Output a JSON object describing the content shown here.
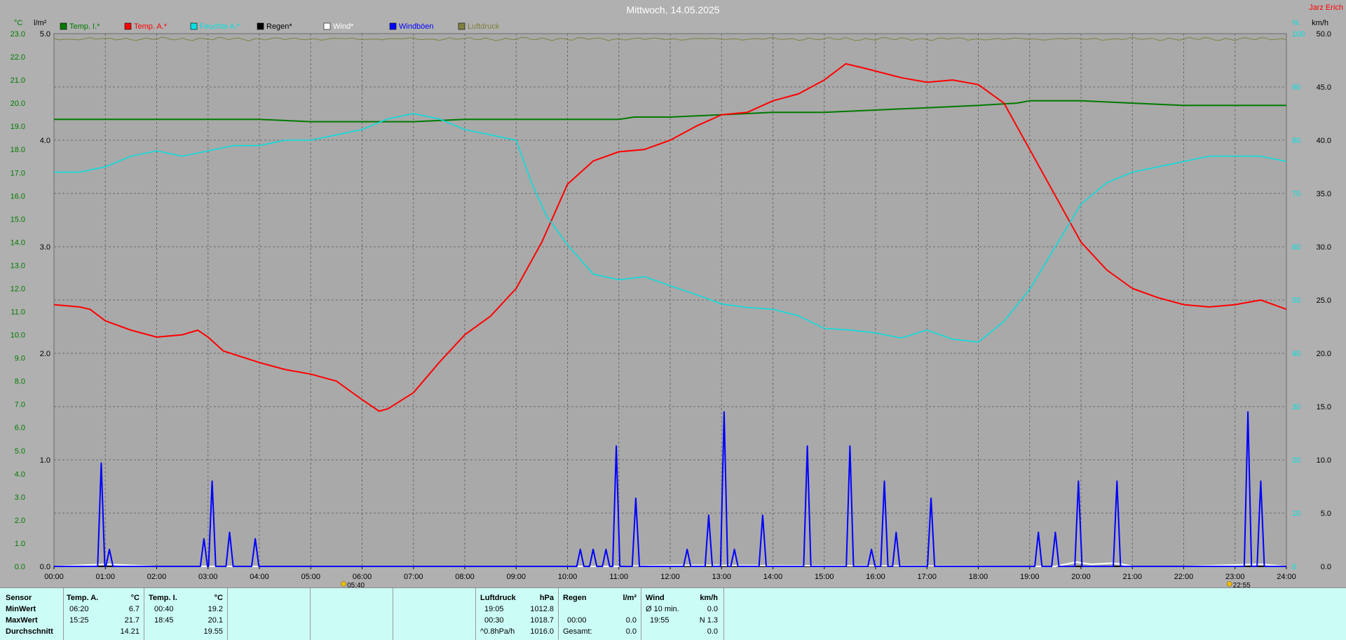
{
  "title": "Mittwoch, 14.05.2025",
  "author": "Jarz Erich",
  "axes": {
    "left_temp_unit": "°C",
    "left_rain_unit": "l/m²",
    "right_pct_unit": "%",
    "right_wind_unit": "km/h",
    "temp_ticks": [
      "0.0",
      "1.0",
      "2.0",
      "3.0",
      "4.0",
      "5.0",
      "6.0",
      "7.0",
      "8.0",
      "9.0",
      "10.0",
      "11.0",
      "12.0",
      "13.0",
      "14.0",
      "15.0",
      "16.0",
      "17.0",
      "18.0",
      "19.0",
      "20.0",
      "21.0",
      "22.0",
      "23.0"
    ],
    "rain_ticks": [
      "1.0",
      "2.0",
      "3.0",
      "4.0",
      "5.0"
    ],
    "pct_ticks": [
      "0",
      "10",
      "20",
      "30",
      "40",
      "50",
      "60",
      "70",
      "80",
      "90",
      "100"
    ],
    "wind_ticks": [
      "0.0",
      "5.0",
      "10.0",
      "15.0",
      "20.0",
      "25.0",
      "30.0",
      "35.0",
      "40.0",
      "45.0",
      "50.0"
    ],
    "x_ticks": [
      "00:00",
      "01:00",
      "02:00",
      "03:00",
      "04:00",
      "05:00",
      "06:00",
      "07:00",
      "08:00",
      "09:00",
      "10:00",
      "11:00",
      "12:00",
      "13:00",
      "14:00",
      "15:00",
      "16:00",
      "17:00",
      "18:00",
      "19:00",
      "20:00",
      "21:00",
      "22:00",
      "23:00",
      "24:00"
    ],
    "sunrise": "05:40",
    "sunset": "22:55"
  },
  "legend": [
    {
      "label": "Temp. I.*",
      "color": "#007a00"
    },
    {
      "label": "Temp. A.*",
      "color": "#ff0000"
    },
    {
      "label": "Feuchte A.*",
      "color": "#00e0e0"
    },
    {
      "label": "Regen*",
      "color": "#000000"
    },
    {
      "label": "Wind*",
      "color": "#ffffff"
    },
    {
      "label": "Windböen",
      "color": "#0000ff"
    },
    {
      "label": "Luftdruck",
      "color": "#808040"
    }
  ],
  "chart_data": {
    "type": "line",
    "x_unit": "hour",
    "xlim": [
      0,
      24
    ],
    "series": [
      {
        "name": "Temp. I.*",
        "axis": "temp",
        "ylim": [
          0,
          23
        ],
        "color": "#007a00",
        "x": [
          0,
          0.5,
          1,
          2,
          3,
          4,
          5,
          6,
          7,
          8,
          9,
          10,
          11,
          11.3,
          12,
          13,
          14,
          15,
          16,
          17,
          18,
          18.75,
          19,
          20,
          21,
          22,
          23,
          24
        ],
        "values": [
          19.3,
          19.3,
          19.3,
          19.3,
          19.3,
          19.3,
          19.2,
          19.2,
          19.2,
          19.3,
          19.3,
          19.3,
          19.3,
          19.4,
          19.4,
          19.5,
          19.6,
          19.6,
          19.7,
          19.8,
          19.9,
          20.0,
          20.1,
          20.1,
          20.0,
          19.9,
          19.9,
          19.9
        ]
      },
      {
        "name": "Temp. A.*",
        "axis": "temp",
        "ylim": [
          0,
          23
        ],
        "color": "#ff0000",
        "x": [
          0,
          0.5,
          0.7,
          1,
          1.5,
          2,
          2.5,
          2.8,
          3,
          3.3,
          4,
          4.5,
          5,
          5.5,
          6,
          6.33,
          6.5,
          7,
          7.5,
          8,
          8.5,
          9,
          9.5,
          10,
          10.5,
          11,
          11.5,
          12,
          12.5,
          13,
          13.5,
          14,
          14.5,
          15,
          15.42,
          15.8,
          16.5,
          17,
          17.5,
          18,
          18.5,
          19,
          19.5,
          20,
          20.5,
          21,
          21.5,
          22,
          22.5,
          23,
          23.5,
          24
        ],
        "values": [
          11.3,
          11.2,
          11.1,
          10.6,
          10.2,
          9.9,
          10.0,
          10.2,
          9.9,
          9.3,
          8.8,
          8.5,
          8.3,
          8.0,
          7.2,
          6.7,
          6.8,
          7.5,
          8.8,
          10.0,
          10.8,
          12.0,
          14.0,
          16.5,
          17.5,
          17.9,
          18.0,
          18.4,
          19.0,
          19.5,
          19.6,
          20.1,
          20.4,
          21.0,
          21.7,
          21.5,
          21.1,
          20.9,
          21.0,
          20.8,
          20.0,
          18.0,
          16.0,
          14.0,
          12.8,
          12.0,
          11.6,
          11.3,
          11.2,
          11.3,
          11.5,
          11.1
        ],
        "min": 6.7,
        "max": 21.7
      },
      {
        "name": "Feuchte A.*",
        "axis": "pct",
        "ylim": [
          0,
          100
        ],
        "color": "#00e0e0",
        "x": [
          0,
          0.5,
          1,
          1.5,
          2,
          2.5,
          3,
          3.5,
          4,
          4.5,
          5,
          5.5,
          6,
          6.5,
          7,
          7.5,
          8,
          8.5,
          9,
          9.3,
          9.6,
          10,
          10.5,
          11,
          11.5,
          12,
          12.5,
          13,
          13.5,
          14,
          14.5,
          15,
          15.5,
          16,
          16.5,
          17,
          17.5,
          18,
          18.5,
          19,
          19.5,
          20,
          20.5,
          21,
          21.5,
          22,
          22.5,
          23,
          23.5,
          24
        ],
        "values": [
          74,
          74,
          75,
          77,
          78,
          77,
          78,
          79,
          79,
          80,
          80,
          81,
          82,
          84,
          85,
          84,
          82,
          81,
          80,
          72,
          66,
          60,
          55,
          54,
          54,
          53,
          51,
          49,
          49,
          48,
          47,
          45,
          44,
          44,
          43,
          44,
          43,
          42,
          46,
          52,
          60,
          68,
          72,
          74,
          75,
          76,
          77,
          77,
          77,
          76
        ]
      },
      {
        "name": "Regen*",
        "axis": "rain",
        "ylim": [
          0,
          5
        ],
        "color": "#000000",
        "x": [
          0,
          24
        ],
        "values": [
          0.0,
          0.0
        ]
      },
      {
        "name": "Wind*",
        "axis": "wind",
        "ylim": [
          0,
          50
        ],
        "color": "#ffffff",
        "x": [
          0,
          1,
          2,
          11,
          12,
          19.5,
          19.9,
          20.2,
          20.6,
          20.8,
          21,
          22,
          23.5,
          24
        ],
        "values": [
          0,
          0.2,
          0,
          0,
          0.1,
          0,
          0.4,
          0.2,
          0.3,
          0.2,
          0,
          0,
          0.2,
          0
        ]
      },
      {
        "name": "Windböen",
        "axis": "wind",
        "ylim": [
          0,
          50
        ],
        "color": "#0000ff",
        "spikes": [
          {
            "x": 0.92,
            "v": 9.7
          },
          {
            "x": 1.08,
            "v": 1.6
          },
          {
            "x": 2.92,
            "v": 2.6
          },
          {
            "x": 3.08,
            "v": 8.0
          },
          {
            "x": 3.42,
            "v": 3.2
          },
          {
            "x": 3.92,
            "v": 2.6
          },
          {
            "x": 10.25,
            "v": 1.6
          },
          {
            "x": 10.5,
            "v": 1.6
          },
          {
            "x": 10.75,
            "v": 1.6
          },
          {
            "x": 10.95,
            "v": 11.3
          },
          {
            "x": 11.33,
            "v": 6.4
          },
          {
            "x": 12.33,
            "v": 1.6
          },
          {
            "x": 12.75,
            "v": 4.8
          },
          {
            "x": 13.05,
            "v": 14.5
          },
          {
            "x": 13.25,
            "v": 1.6
          },
          {
            "x": 13.8,
            "v": 4.8
          },
          {
            "x": 14.67,
            "v": 11.3
          },
          {
            "x": 15.5,
            "v": 11.3
          },
          {
            "x": 15.92,
            "v": 1.6
          },
          {
            "x": 16.17,
            "v": 8.0
          },
          {
            "x": 16.4,
            "v": 3.2
          },
          {
            "x": 17.08,
            "v": 6.4
          },
          {
            "x": 19.17,
            "v": 3.2
          },
          {
            "x": 19.5,
            "v": 3.2
          },
          {
            "x": 19.95,
            "v": 8.0
          },
          {
            "x": 20.7,
            "v": 8.0
          },
          {
            "x": 23.25,
            "v": 14.5
          },
          {
            "x": 23.5,
            "v": 8.0
          }
        ]
      },
      {
        "name": "Luftdruck",
        "axis": "pct",
        "ylim": [
          0,
          100
        ],
        "color": "#808040",
        "note": "noisy line near top of plot",
        "values_base": 99
      }
    ]
  },
  "stats": {
    "rows": [
      "Sensor",
      "MinWert",
      "MaxWert",
      "Durchschnitt"
    ],
    "temp_a": {
      "header": "Temp. A.",
      "unit": "°C",
      "min_time": "06:20",
      "min": "6.7",
      "max_time": "15:25",
      "max": "21.7",
      "avg": "14.21"
    },
    "temp_i": {
      "header": "Temp. I.",
      "unit": "°C",
      "min_time": "00:40",
      "min": "19.2",
      "max_time": "18:45",
      "max": "20.1",
      "avg": "19.55"
    },
    "pressure": {
      "header": "Luftdruck",
      "unit": "hPa",
      "min_time": "19:05",
      "min": "1012.8",
      "max_time": "00:30",
      "max": "1018.7",
      "trend_label": "^0.8hPa/h",
      "trend_val": "1016.0"
    },
    "rain": {
      "header": "Regen",
      "unit": "l/m²",
      "row2_time": "00:00",
      "row2_val": "0.0",
      "row3_label": "Gesamt:",
      "row3_val": "0.0"
    },
    "wind": {
      "header": "Wind",
      "unit": "km/h",
      "row1_label": "Ø 10 min.",
      "row1_val": "0.0",
      "row2_time": "19:55",
      "row2_val": "N 1.3",
      "row3_val": "0.0"
    }
  }
}
